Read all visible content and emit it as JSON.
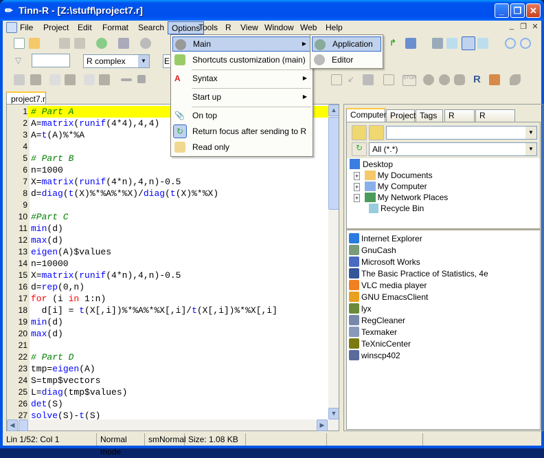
{
  "window": {
    "title": "Tinn-R - [Z:\\stuff\\project7.r]",
    "minimize": "_",
    "restore": "❐",
    "close": "✕"
  },
  "menubar": [
    "File",
    "Project",
    "Edit",
    "Format",
    "Search",
    "Options",
    "Tools",
    "R",
    "View",
    "Window",
    "Web",
    "Help"
  ],
  "menubar_open": "Options",
  "toolbar": {
    "search_input": "",
    "syntax_combo": "R complex",
    "third_combo": "E"
  },
  "document_tab": "project7.r",
  "editor": {
    "current_line": 1,
    "lines": [
      [
        [
          "# Part A",
          "cmt"
        ]
      ],
      [
        [
          "A=",
          "txt"
        ],
        [
          "matrix",
          "fn"
        ],
        [
          "(",
          "txt"
        ],
        [
          "runif",
          "fn"
        ],
        [
          "(4*4),4,4)",
          "txt"
        ]
      ],
      [
        [
          "A=",
          "txt"
        ],
        [
          "t",
          "fn"
        ],
        [
          "(A)%*%A",
          "txt"
        ]
      ],
      [],
      [
        [
          "# Part B",
          "cmt"
        ]
      ],
      [
        [
          "n=1000",
          "txt"
        ]
      ],
      [
        [
          "X=",
          "txt"
        ],
        [
          "matrix",
          "fn"
        ],
        [
          "(",
          "txt"
        ],
        [
          "runif",
          "fn"
        ],
        [
          "(4*n),4,n)-0.5",
          "txt"
        ]
      ],
      [
        [
          "d=",
          "txt"
        ],
        [
          "diag",
          "fn"
        ],
        [
          "(",
          "txt"
        ],
        [
          "t",
          "fn"
        ],
        [
          "(X)%*%A%*%X)/",
          "txt"
        ],
        [
          "diag",
          "fn"
        ],
        [
          "(",
          "txt"
        ],
        [
          "t",
          "fn"
        ],
        [
          "(X)%*%X)",
          "txt"
        ]
      ],
      [],
      [
        [
          "#Part C",
          "cmt"
        ]
      ],
      [
        [
          "min",
          "fn"
        ],
        [
          "(d)",
          "txt"
        ]
      ],
      [
        [
          "max",
          "fn"
        ],
        [
          "(d)",
          "txt"
        ]
      ],
      [
        [
          "eigen",
          "fn"
        ],
        [
          "(A)$values",
          "txt"
        ]
      ],
      [
        [
          "n=10000",
          "txt"
        ]
      ],
      [
        [
          "X=",
          "txt"
        ],
        [
          "matrix",
          "fn"
        ],
        [
          "(",
          "txt"
        ],
        [
          "runif",
          "fn"
        ],
        [
          "(4*n),4,n)-0.5",
          "txt"
        ]
      ],
      [
        [
          "d=",
          "txt"
        ],
        [
          "rep",
          "fn"
        ],
        [
          "(0,n)",
          "txt"
        ]
      ],
      [
        [
          "for",
          "kw"
        ],
        [
          " (i ",
          "txt"
        ],
        [
          "in",
          "kw"
        ],
        [
          " 1:n)",
          "txt"
        ]
      ],
      [
        [
          "  d[i] = ",
          "txt"
        ],
        [
          "t",
          "fn"
        ],
        [
          "(X[,i])%*%A%*%X[,i]/",
          "txt"
        ],
        [
          "t",
          "fn"
        ],
        [
          "(X[,i])%*%X[,i]",
          "txt"
        ]
      ],
      [
        [
          "min",
          "fn"
        ],
        [
          "(d)",
          "txt"
        ]
      ],
      [
        [
          "max",
          "fn"
        ],
        [
          "(d)",
          "txt"
        ]
      ],
      [],
      [
        [
          "# Part D",
          "cmt"
        ]
      ],
      [
        [
          "tmp=",
          "txt"
        ],
        [
          "eigen",
          "fn"
        ],
        [
          "(A)",
          "txt"
        ]
      ],
      [
        [
          "S=tmp$vectors",
          "txt"
        ]
      ],
      [
        [
          "L=",
          "txt"
        ],
        [
          "diag",
          "fn"
        ],
        [
          "(tmp$values)",
          "txt"
        ]
      ],
      [
        [
          "det",
          "fn"
        ],
        [
          "(S)",
          "txt"
        ]
      ],
      [
        [
          "solve",
          "fn"
        ],
        [
          "(S)-",
          "txt"
        ],
        [
          "t",
          "fn"
        ],
        [
          "(S)",
          "txt"
        ]
      ]
    ]
  },
  "options_menu": [
    {
      "label": "Main",
      "icon": "gear-icon",
      "submenu": true,
      "highlighted": true
    },
    {
      "label": "Shortcuts customization (main)",
      "icon": "shortcuts-icon"
    },
    {
      "label": "Syntax",
      "icon": "syntax-icon",
      "submenu": true
    },
    {
      "label": "Start up",
      "submenu": true
    },
    {
      "label": "On top",
      "icon": "paperclip-icon"
    },
    {
      "label": "Return focus after sending to R",
      "icon": "refresh-icon",
      "checked": true
    },
    {
      "label": "Read only",
      "icon": "lock-icon"
    }
  ],
  "main_submenu": [
    {
      "label": "Application",
      "highlighted": true
    },
    {
      "label": "Editor"
    }
  ],
  "right_panel": {
    "tabs": [
      "Computer",
      "Project",
      "Tags",
      "R card",
      "R explorer"
    ],
    "active_tab": "Computer",
    "favorites_combo": "",
    "filter_combo": "All (*.*)",
    "tree": [
      "Desktop",
      "My Documents",
      "My Computer",
      "My Network Places",
      "Recycle Bin"
    ],
    "shortcuts": [
      "Internet Explorer",
      "GnuCash",
      "Microsoft Works",
      "The Basic Practice of Statistics, 4e",
      "VLC media player",
      "GNU EmacsClient",
      "lyx",
      "RegCleaner",
      "Texmaker",
      "TeXnicCenter",
      "winscp402"
    ]
  },
  "status": {
    "position": "Lin 1/52: Col 1",
    "mode": "Normal mode",
    "sm": "smNormal",
    "size": "Size: 1.08 KB"
  },
  "colors": {
    "titlebar": "#0053ee",
    "menu_highlight": "#c1d2ee",
    "current_line": "#ffff00",
    "comment": "#008000",
    "function": "#0000ff",
    "keyword": "#ff0000"
  }
}
